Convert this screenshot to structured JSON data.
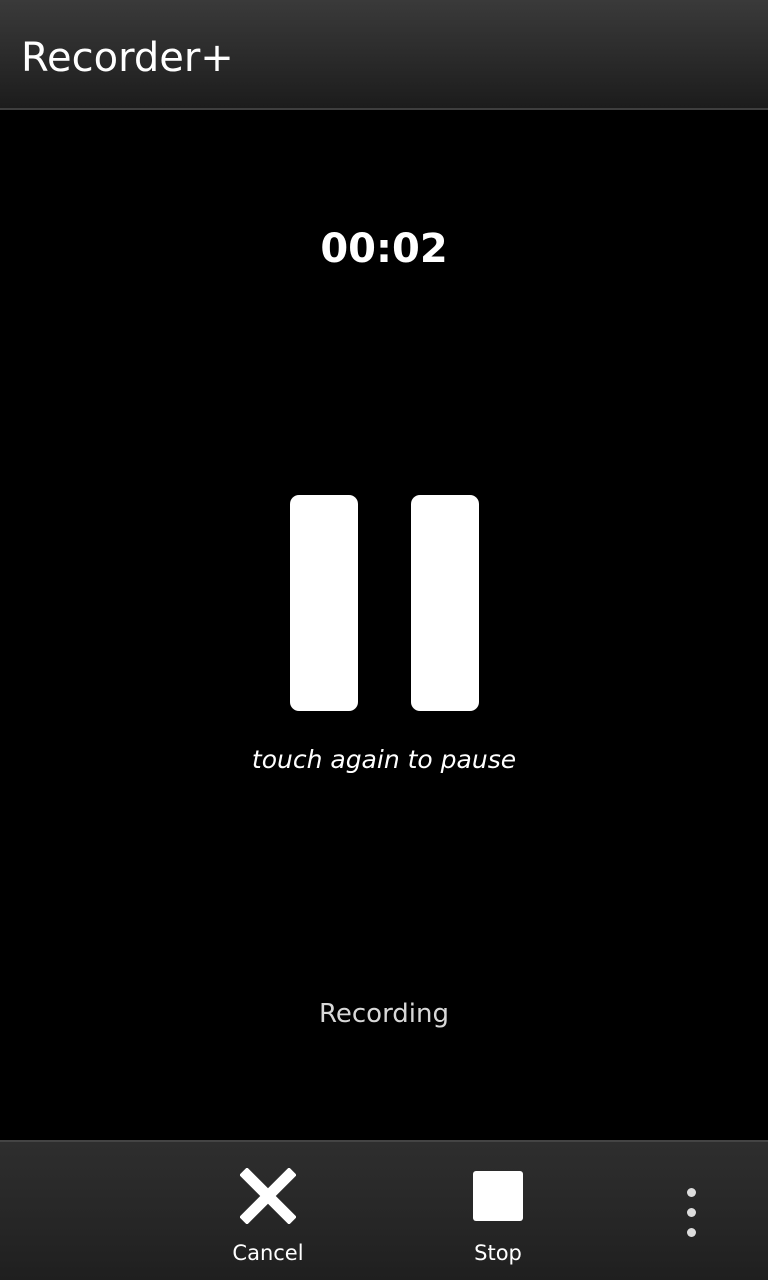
{
  "app": {
    "title": "Recorder+"
  },
  "recorder": {
    "elapsed": "00:02",
    "hint": "touch again to pause",
    "status": "Recording"
  },
  "actions": {
    "cancel_label": "Cancel",
    "stop_label": "Stop"
  },
  "icons": {
    "pause": "pause-icon",
    "cancel": "close-icon",
    "stop": "stop-icon",
    "overflow": "more-vertical-icon"
  },
  "colors": {
    "background": "#000000",
    "bar": "#2a2a2a",
    "foreground": "#ffffff"
  }
}
